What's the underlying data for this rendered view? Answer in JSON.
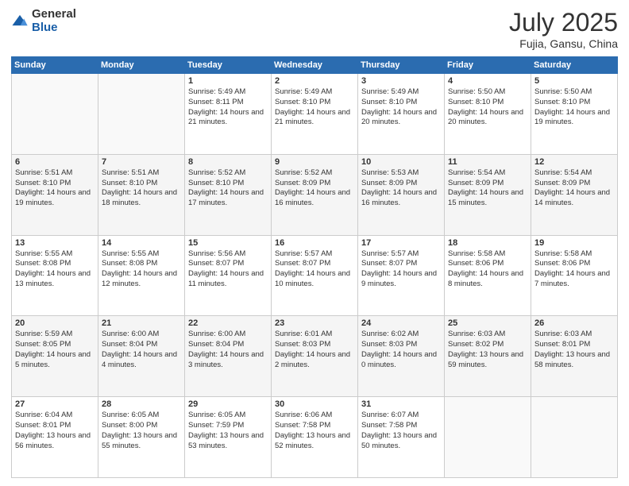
{
  "logo": {
    "general": "General",
    "blue": "Blue"
  },
  "header": {
    "month": "July 2025",
    "location": "Fujia, Gansu, China"
  },
  "weekdays": [
    "Sunday",
    "Monday",
    "Tuesday",
    "Wednesday",
    "Thursday",
    "Friday",
    "Saturday"
  ],
  "weeks": [
    [
      {
        "day": "",
        "info": ""
      },
      {
        "day": "",
        "info": ""
      },
      {
        "day": "1",
        "info": "Sunrise: 5:49 AM\nSunset: 8:11 PM\nDaylight: 14 hours and 21 minutes."
      },
      {
        "day": "2",
        "info": "Sunrise: 5:49 AM\nSunset: 8:10 PM\nDaylight: 14 hours and 21 minutes."
      },
      {
        "day": "3",
        "info": "Sunrise: 5:49 AM\nSunset: 8:10 PM\nDaylight: 14 hours and 20 minutes."
      },
      {
        "day": "4",
        "info": "Sunrise: 5:50 AM\nSunset: 8:10 PM\nDaylight: 14 hours and 20 minutes."
      },
      {
        "day": "5",
        "info": "Sunrise: 5:50 AM\nSunset: 8:10 PM\nDaylight: 14 hours and 19 minutes."
      }
    ],
    [
      {
        "day": "6",
        "info": "Sunrise: 5:51 AM\nSunset: 8:10 PM\nDaylight: 14 hours and 19 minutes."
      },
      {
        "day": "7",
        "info": "Sunrise: 5:51 AM\nSunset: 8:10 PM\nDaylight: 14 hours and 18 minutes."
      },
      {
        "day": "8",
        "info": "Sunrise: 5:52 AM\nSunset: 8:10 PM\nDaylight: 14 hours and 17 minutes."
      },
      {
        "day": "9",
        "info": "Sunrise: 5:52 AM\nSunset: 8:09 PM\nDaylight: 14 hours and 16 minutes."
      },
      {
        "day": "10",
        "info": "Sunrise: 5:53 AM\nSunset: 8:09 PM\nDaylight: 14 hours and 16 minutes."
      },
      {
        "day": "11",
        "info": "Sunrise: 5:54 AM\nSunset: 8:09 PM\nDaylight: 14 hours and 15 minutes."
      },
      {
        "day": "12",
        "info": "Sunrise: 5:54 AM\nSunset: 8:09 PM\nDaylight: 14 hours and 14 minutes."
      }
    ],
    [
      {
        "day": "13",
        "info": "Sunrise: 5:55 AM\nSunset: 8:08 PM\nDaylight: 14 hours and 13 minutes."
      },
      {
        "day": "14",
        "info": "Sunrise: 5:55 AM\nSunset: 8:08 PM\nDaylight: 14 hours and 12 minutes."
      },
      {
        "day": "15",
        "info": "Sunrise: 5:56 AM\nSunset: 8:07 PM\nDaylight: 14 hours and 11 minutes."
      },
      {
        "day": "16",
        "info": "Sunrise: 5:57 AM\nSunset: 8:07 PM\nDaylight: 14 hours and 10 minutes."
      },
      {
        "day": "17",
        "info": "Sunrise: 5:57 AM\nSunset: 8:07 PM\nDaylight: 14 hours and 9 minutes."
      },
      {
        "day": "18",
        "info": "Sunrise: 5:58 AM\nSunset: 8:06 PM\nDaylight: 14 hours and 8 minutes."
      },
      {
        "day": "19",
        "info": "Sunrise: 5:58 AM\nSunset: 8:06 PM\nDaylight: 14 hours and 7 minutes."
      }
    ],
    [
      {
        "day": "20",
        "info": "Sunrise: 5:59 AM\nSunset: 8:05 PM\nDaylight: 14 hours and 5 minutes."
      },
      {
        "day": "21",
        "info": "Sunrise: 6:00 AM\nSunset: 8:04 PM\nDaylight: 14 hours and 4 minutes."
      },
      {
        "day": "22",
        "info": "Sunrise: 6:00 AM\nSunset: 8:04 PM\nDaylight: 14 hours and 3 minutes."
      },
      {
        "day": "23",
        "info": "Sunrise: 6:01 AM\nSunset: 8:03 PM\nDaylight: 14 hours and 2 minutes."
      },
      {
        "day": "24",
        "info": "Sunrise: 6:02 AM\nSunset: 8:03 PM\nDaylight: 14 hours and 0 minutes."
      },
      {
        "day": "25",
        "info": "Sunrise: 6:03 AM\nSunset: 8:02 PM\nDaylight: 13 hours and 59 minutes."
      },
      {
        "day": "26",
        "info": "Sunrise: 6:03 AM\nSunset: 8:01 PM\nDaylight: 13 hours and 58 minutes."
      }
    ],
    [
      {
        "day": "27",
        "info": "Sunrise: 6:04 AM\nSunset: 8:01 PM\nDaylight: 13 hours and 56 minutes."
      },
      {
        "day": "28",
        "info": "Sunrise: 6:05 AM\nSunset: 8:00 PM\nDaylight: 13 hours and 55 minutes."
      },
      {
        "day": "29",
        "info": "Sunrise: 6:05 AM\nSunset: 7:59 PM\nDaylight: 13 hours and 53 minutes."
      },
      {
        "day": "30",
        "info": "Sunrise: 6:06 AM\nSunset: 7:58 PM\nDaylight: 13 hours and 52 minutes."
      },
      {
        "day": "31",
        "info": "Sunrise: 6:07 AM\nSunset: 7:58 PM\nDaylight: 13 hours and 50 minutes."
      },
      {
        "day": "",
        "info": ""
      },
      {
        "day": "",
        "info": ""
      }
    ]
  ]
}
